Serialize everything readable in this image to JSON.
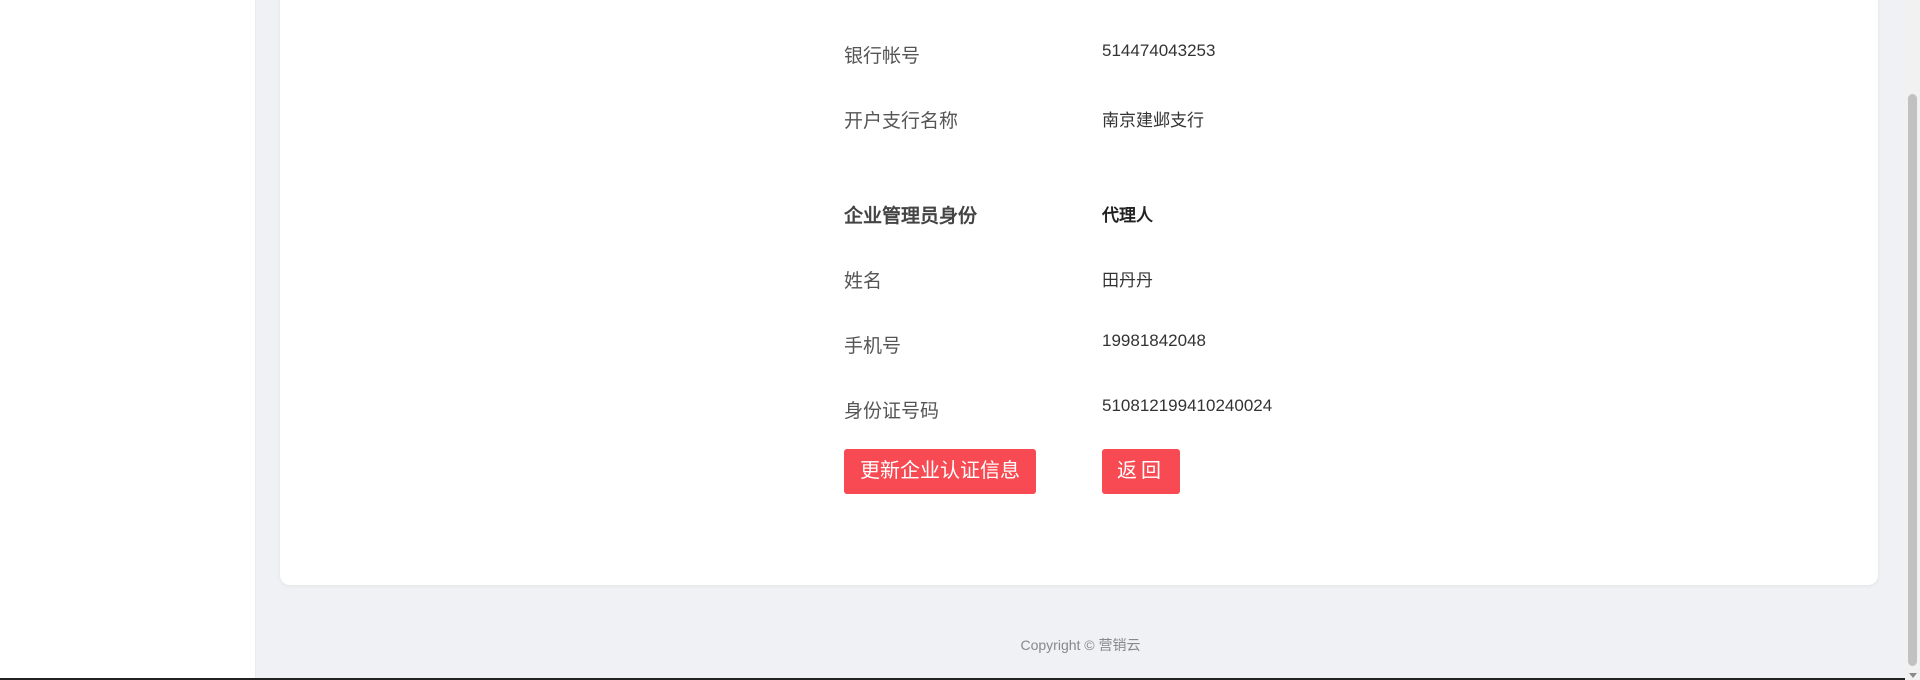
{
  "details": {
    "bank_account": {
      "label": "银行帐号",
      "value": "514474043253"
    },
    "branch_name": {
      "label": "开户支行名称",
      "value": "南京建邺支行"
    },
    "admin_identity": {
      "label": "企业管理员身份",
      "value": "代理人"
    },
    "name": {
      "label": "姓名",
      "value": "田丹丹"
    },
    "phone": {
      "label": "手机号",
      "value": "19981842048"
    },
    "id_number": {
      "label": "身份证号码",
      "value": "510812199410240024"
    }
  },
  "actions": {
    "update_label": "更新企业认证信息",
    "back_label": "返回"
  },
  "footer": {
    "copyright": "Copyright © 营销云"
  },
  "colors": {
    "primary": "#f74a52",
    "background": "#f0f1f4",
    "card": "#ffffff"
  }
}
